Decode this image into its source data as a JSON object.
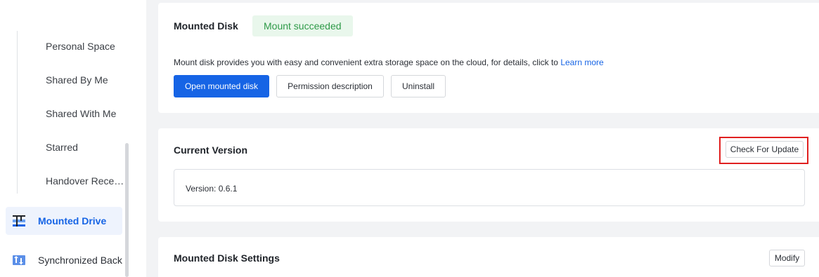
{
  "sidebar": {
    "sub_items": [
      {
        "label": "Personal Space"
      },
      {
        "label": "Shared By Me"
      },
      {
        "label": "Shared With Me"
      },
      {
        "label": "Starred"
      },
      {
        "label": "Handover Recei..."
      }
    ],
    "nav_items": [
      {
        "label": "Mounted Drive",
        "icon": "mounted-drive-icon",
        "active": true
      },
      {
        "label": "Synchronized Backup",
        "icon": "sync-backup-icon",
        "active": false
      }
    ]
  },
  "mounted_disk": {
    "title": "Mounted Disk",
    "status": "Mount succeeded",
    "description": "Mount disk provides you with easy and convenient extra storage space on the cloud, for details, click to",
    "learn_more": "Learn more",
    "buttons": {
      "open": "Open mounted disk",
      "permission": "Permission description",
      "uninstall": "Uninstall"
    }
  },
  "current_version": {
    "title": "Current Version",
    "check_update": "Check For Update",
    "version_text": "Version: 0.6.1"
  },
  "settings": {
    "title": "Mounted Disk Settings",
    "modify": "Modify"
  },
  "colors": {
    "accent": "#1664e5",
    "success_text": "#2e9a48",
    "success_bg": "#e9f7ec",
    "highlight": "#e02020"
  }
}
